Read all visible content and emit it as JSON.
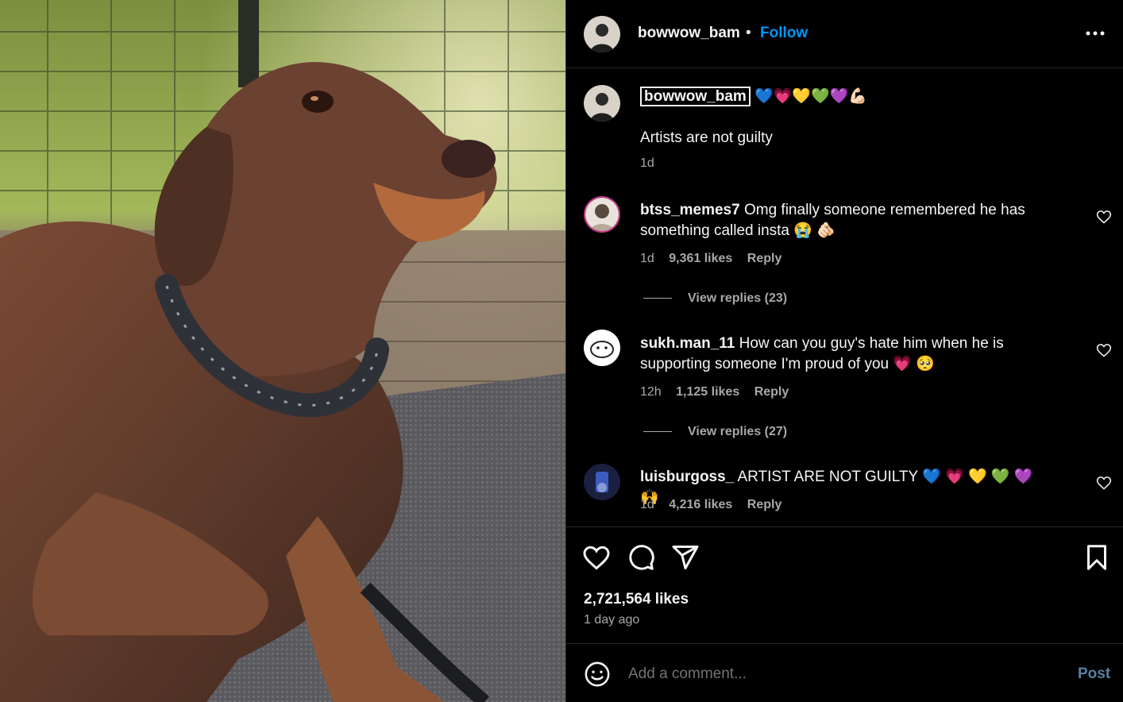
{
  "post": {
    "username": "bowwow_bam",
    "separator": "•",
    "follow_label": "Follow",
    "more_icon": "more-horizontal-icon"
  },
  "caption": {
    "username": "bowwow_bam",
    "emojis": "💙💗💛💚💜💪🏻",
    "text": "Artists are not guilty",
    "time": "1d"
  },
  "comments": [
    {
      "username": "btss_memes7",
      "text_line1": "Omg finally someone remembered he has",
      "text_line2": "something called insta 😭 🫵🏻",
      "time": "1d",
      "likes": "9,361 likes",
      "reply": "Reply",
      "view_replies": "View replies (23)"
    },
    {
      "username": "sukh.man_11",
      "text_line1": "How can you guy's hate him when he is",
      "text_line2": "supporting someone I'm proud of you 💗 🥺",
      "time": "12h",
      "likes": "1,125 likes",
      "reply": "Reply",
      "view_replies": "View replies (27)"
    },
    {
      "username": "luisburgoss_",
      "text_line1": "ARTIST ARE NOT GUILTY 💙 💗 💛 💚 💜 🙌",
      "time": "1d",
      "likes": "4,216 likes",
      "reply": "Reply"
    }
  ],
  "actions": {
    "icons": [
      "heart-icon",
      "comment-icon",
      "share-icon",
      "bookmark-icon"
    ],
    "likes": "2,721,564 likes",
    "time_ago": "1 day ago"
  },
  "add_comment": {
    "placeholder": "Add a comment...",
    "post_label": "Post",
    "emoji_icon": "emoji-icon"
  },
  "colors": {
    "background": "#000000",
    "text": "#f5f5f5",
    "secondary_text": "#a8a8a8",
    "link_blue": "#0095f6",
    "post_disabled": "#5a7fa3",
    "divider": "#262626"
  }
}
